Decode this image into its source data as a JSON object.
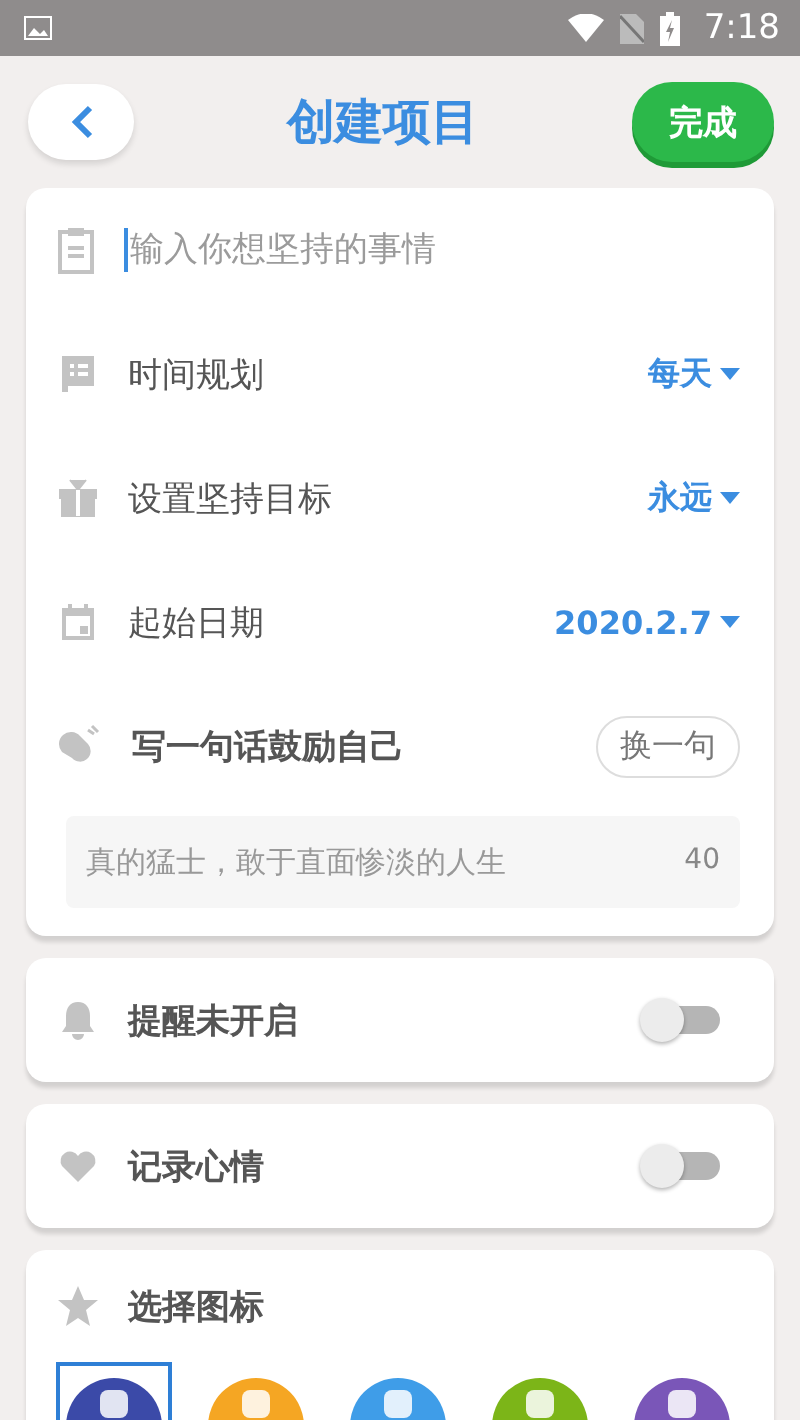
{
  "status_bar": {
    "time": "7:18"
  },
  "header": {
    "title": "创建项目",
    "done_button": "完成"
  },
  "form": {
    "name_field": {
      "placeholder": "输入你想坚持的事情"
    },
    "options": [
      {
        "kind": "schedule",
        "label": "时间规划",
        "value": "每天"
      },
      {
        "kind": "goal",
        "label": "设置坚持目标",
        "value": "永远"
      },
      {
        "kind": "date",
        "label": "起始日期",
        "value": "2020.2.7"
      }
    ],
    "motto": {
      "label": "写一句话鼓励自己",
      "change_button": "换一句",
      "placeholder": "真的猛士，敢于直面惨淡的人生",
      "count": "40"
    }
  },
  "toggles": [
    {
      "kind": "reminder",
      "label": "提醒未开启",
      "on": false
    },
    {
      "kind": "mood",
      "label": "记录心情",
      "on": false
    }
  ],
  "icon_picker": {
    "label": "选择图标",
    "icons": [
      {
        "color": "#3b4aa8",
        "selected": true
      },
      {
        "color": "#f5a623",
        "selected": false
      },
      {
        "color": "#3f9de8",
        "selected": false
      },
      {
        "color": "#7cb518",
        "selected": false
      },
      {
        "color": "#7a56b8",
        "selected": false
      }
    ]
  }
}
